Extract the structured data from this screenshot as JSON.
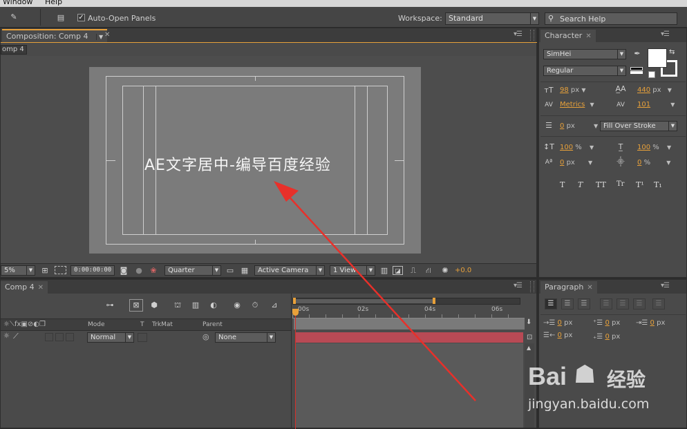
{
  "menu": {
    "window": "Window",
    "help": "Help"
  },
  "toolbar": {
    "auto_open_label": "Auto-Open Panels",
    "workspace_label": "Workspace:",
    "workspace_value": "Standard",
    "search_label": "Search Help"
  },
  "composition": {
    "tab_label": "Composition: Comp 4",
    "crumb": "omp 4",
    "overlay_text": "AE文字居中-编导百度经验",
    "zoom": "5%",
    "timecode": "0:00:00:00",
    "resolution": "Quarter",
    "camera": "Active Camera",
    "views": "1 View",
    "exposure": "+0.0"
  },
  "timeline": {
    "tab_label": "Comp 4",
    "columns": {
      "mode": "Mode",
      "t": "T",
      "trkmat": "TrkMat",
      "parent": "Parent"
    },
    "layer": {
      "mode": "Normal",
      "parent": "None"
    },
    "ruler": [
      "00s",
      "02s",
      "04s",
      "06s"
    ]
  },
  "character": {
    "tab_label": "Character",
    "font": "SimHei",
    "style": "Regular",
    "size": "98",
    "leading": "440",
    "kerning": "Metrics",
    "tracking": "101",
    "stroke_width": "0",
    "stroke_type": "Fill Over Stroke",
    "vscale": "100",
    "hscale": "100",
    "baseline": "0",
    "tsume": "0",
    "px": "px",
    "pct": "%",
    "styles": [
      "T",
      "T",
      "TT",
      "Tr",
      "T¹",
      "T₁"
    ]
  },
  "paragraph": {
    "tab_label": "Paragraph",
    "indent_left": "0",
    "indent_before": "0",
    "indent_first": "0",
    "indent_right": "0",
    "space_after": "0",
    "px": "px"
  },
  "watermark": {
    "brand_a": "Bai",
    "brand_b": "经验",
    "url": "jingyan.baidu.com"
  },
  "colors": {
    "accent": "#e8a13a",
    "arrow": "#e8302a",
    "bar": "#b84a55"
  }
}
